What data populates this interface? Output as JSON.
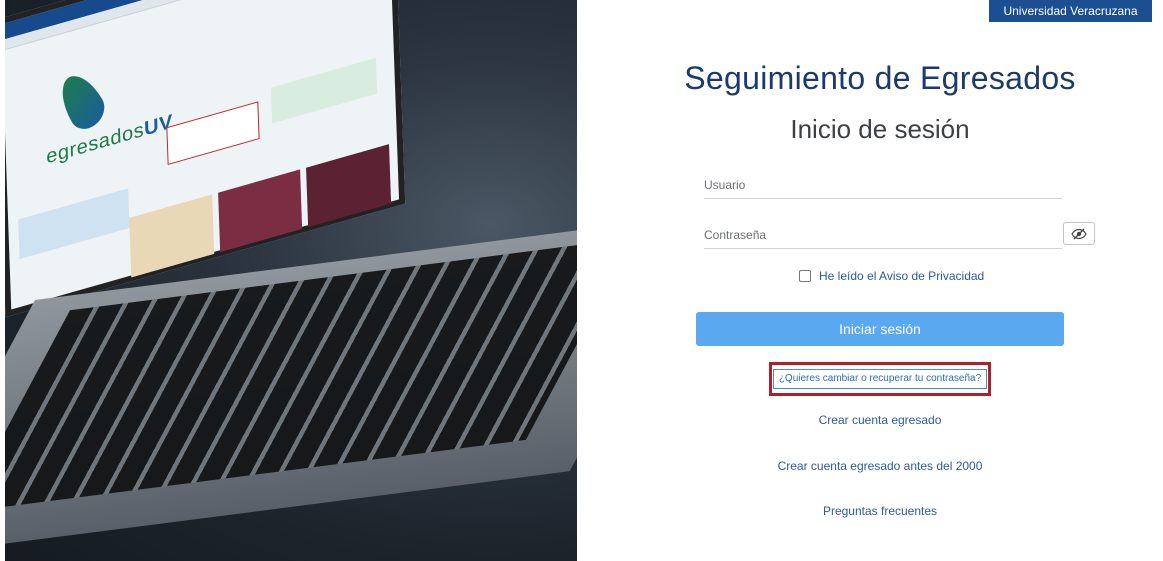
{
  "header": {
    "badge": "Universidad Veracruzana"
  },
  "photo": {
    "screen_logo_main": "egresados",
    "screen_logo_accent": "UV"
  },
  "login": {
    "title": "Seguimiento de Egresados",
    "subtitle": "Inicio de sesión",
    "username": {
      "placeholder": "Usuario",
      "value": ""
    },
    "password": {
      "placeholder": "Contraseña",
      "value": ""
    },
    "privacy_label": "He leído el Aviso de Privacidad",
    "privacy_checked": false,
    "submit_label": "Iniciar sesión",
    "recover_label": "¿Quieres cambiar o recuperar tu contraseña?",
    "links": {
      "create_account": "Crear cuenta egresado",
      "create_account_pre2000": "Crear cuenta egresado antes del 2000",
      "faq": "Preguntas frecuentes"
    }
  },
  "colors": {
    "badge_bg": "#1b4f91",
    "title": "#1b3a6b",
    "submit_bg": "#5aa9f0",
    "link": "#2c5aa0",
    "highlight": "#b0202a"
  }
}
